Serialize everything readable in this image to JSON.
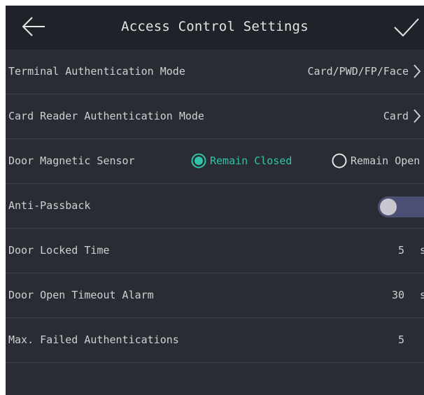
{
  "header": {
    "title": "Access Control Settings",
    "back_icon": "arrow-left-icon",
    "confirm_icon": "checkmark-icon"
  },
  "rows": [
    {
      "label": "Terminal Authentication Mode",
      "value": "Card/PWD/FP/Face"
    },
    {
      "label": "Card Reader Authentication Mode",
      "value": "Card"
    },
    {
      "label": "Door Magnetic Sensor",
      "options": [
        {
          "label": "Remain Closed",
          "selected": true
        },
        {
          "label": "Remain Open",
          "selected": false
        }
      ]
    },
    {
      "label": "Anti-Passback",
      "enabled": false
    },
    {
      "label": "Door Locked Time",
      "value": "5",
      "unit": "s"
    },
    {
      "label": "Door Open Timeout Alarm",
      "value": "30",
      "unit": "s"
    },
    {
      "label": "Max. Failed Authentications",
      "value": "5"
    }
  ],
  "colors": {
    "background": "#292c33",
    "header": "#1f2228",
    "text": "#cfd0d3",
    "accent": "#2ec4a8",
    "toggle_track": "#4c4e73"
  }
}
